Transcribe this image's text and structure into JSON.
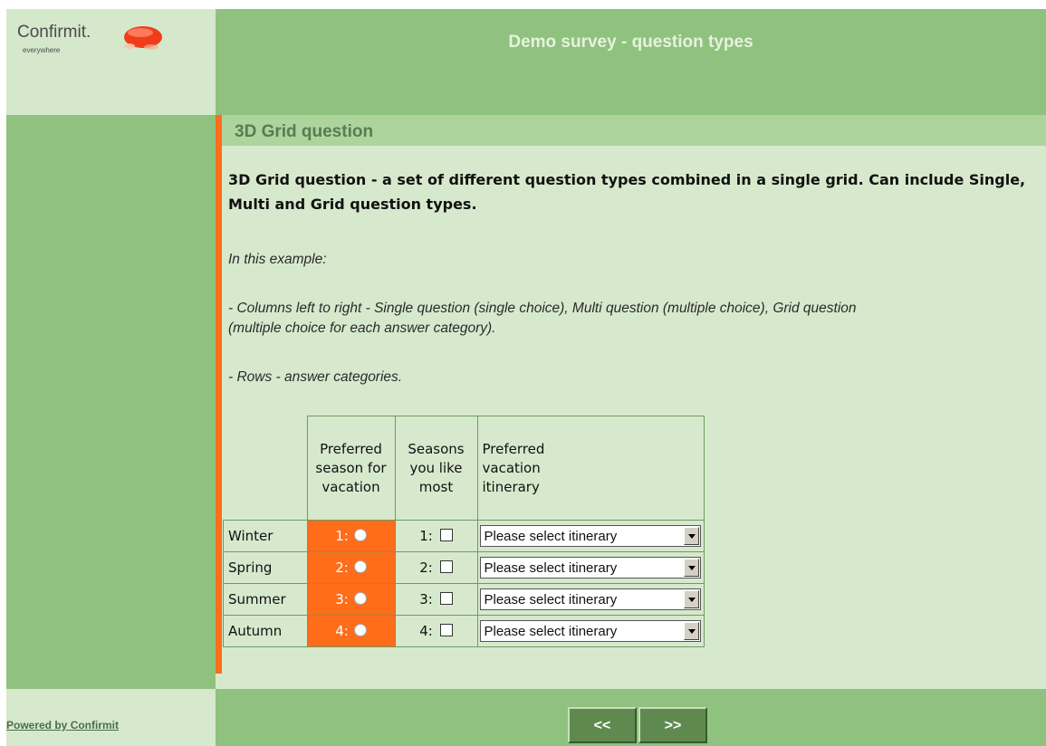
{
  "logo": {
    "brand": "Confirmit.",
    "tagline": "everywhere"
  },
  "header": {
    "title": "Demo survey - question types"
  },
  "question": {
    "title": "3D Grid question",
    "text": "3D Grid question - a set of different question types combined in a single grid. Can include Single, Multi and Grid question types.",
    "info_intro": "In this example:",
    "info_columns_line1": "- Columns left to right - Single question (single choice), Multi question (multiple choice), Grid question",
    "info_columns_line2": "(multiple choice for each answer category).",
    "info_rows": "- Rows - answer categories."
  },
  "grid": {
    "columns": [
      "Preferred season for vacation",
      "Seasons you like most",
      "Preferred vacation itinerary"
    ],
    "rows": [
      {
        "label": "Winter",
        "single": "1:",
        "multi": "1:",
        "select": "Please select itinerary"
      },
      {
        "label": "Spring",
        "single": "2:",
        "multi": "2:",
        "select": "Please select itinerary"
      },
      {
        "label": "Summer",
        "single": "3:",
        "multi": "3:",
        "select": "Please select itinerary"
      },
      {
        "label": "Autumn",
        "single": "4:",
        "multi": "4:",
        "select": "Please select itinerary"
      }
    ]
  },
  "footer": {
    "powered": "Powered by Confirmit",
    "prev": "<<",
    "next": ">>"
  },
  "colors": {
    "accent": "#ff6c1a",
    "header_green": "#8fc27e",
    "panel_green": "#d6e9cd"
  }
}
